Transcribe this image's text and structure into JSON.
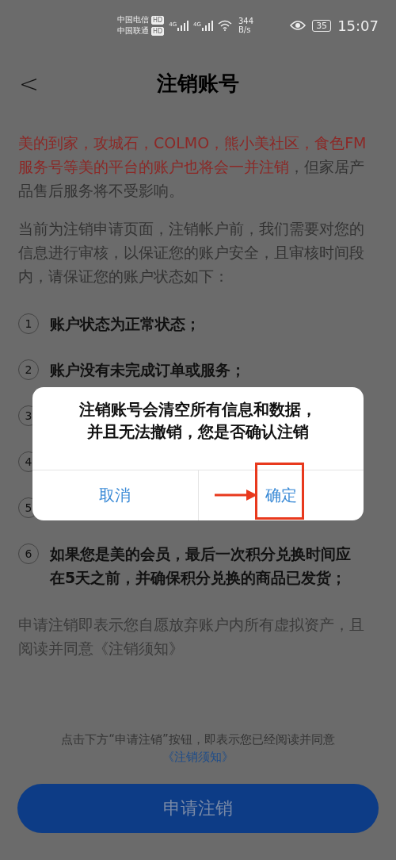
{
  "status_bar": {
    "carriers": [
      {
        "name": "中国电信",
        "badge": "HD"
      },
      {
        "name": "中国联通",
        "badge": "HD"
      }
    ],
    "signals": [
      "4G",
      "4G"
    ],
    "speed": "344",
    "speed_unit": "B/s",
    "battery": "35",
    "time": "15:07"
  },
  "header": {
    "back": "<",
    "title": "注销账号"
  },
  "notice": {
    "segments": [
      {
        "text": "美的到家，攻城石，COLMO，熊小美社区，食色FM服务号等美的平台的账户也将会一并注销",
        "emphasis": true
      },
      {
        "text": "，但家居产品售后服务将不受影响。",
        "emphasis": false
      }
    ],
    "intro": "当前为注销申请页面，注销帐户前，我们需要对您的信息进行审核，以保证您的账户安全，且审核时间段内，请保证您的账户状态如下：",
    "conditions": [
      {
        "number": "1",
        "text": "账户状态为正常状态；"
      },
      {
        "number": "2",
        "text": "账户没有未完成订单或服务；"
      },
      {
        "number": "3"
      },
      {
        "number": "4"
      },
      {
        "number": "5"
      },
      {
        "number": "6",
        "text": "如果您是美的会员，最后一次积分兑换时间应在5天之前，并确保积分兑换的商品已发货；"
      }
    ],
    "consent": "申请注销即表示您自愿放弃账户内所有虚拟资产，且阅读并同意《注销须知》"
  },
  "footer": {
    "note": "点击下方“申请注销”按钮，即表示您已经阅读并同意",
    "link": "《注销须知》",
    "button": "申请注销"
  },
  "dialog": {
    "message": [
      "注销账号会清空所有信息和数据，",
      "并且无法撤销，您是否确认注销"
    ],
    "buttons": [
      {
        "label": "取消",
        "highlighted": false
      },
      {
        "label": "确定",
        "highlighted": true
      }
    ]
  }
}
